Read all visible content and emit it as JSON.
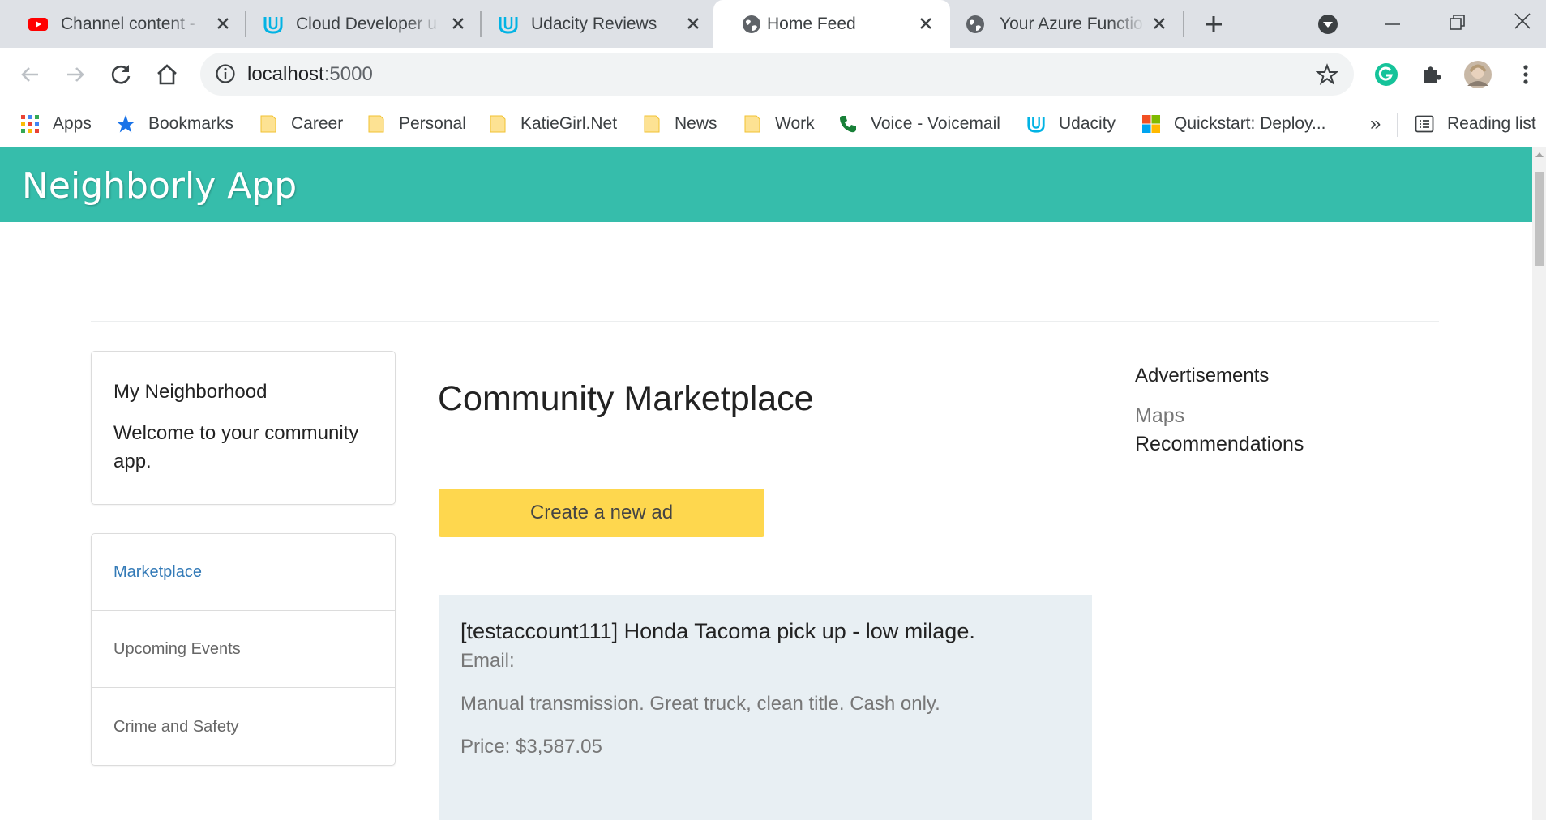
{
  "browser": {
    "tabs": [
      {
        "title": "Channel content -",
        "icon": "youtube-icon"
      },
      {
        "title": "Cloud Developer u",
        "icon": "udacity-icon"
      },
      {
        "title": "Udacity Reviews",
        "icon": "udacity-icon"
      },
      {
        "title": "Home Feed",
        "icon": "globe-icon",
        "active": true
      },
      {
        "title": "Your Azure Functio",
        "icon": "globe-icon"
      }
    ],
    "address": {
      "host": "localhost",
      "port": ":5000"
    },
    "bookmarks": [
      {
        "label": "Apps",
        "icon": "apps-grid-icon"
      },
      {
        "label": "Bookmarks",
        "icon": "star-icon"
      },
      {
        "label": "Career",
        "icon": "folder-icon"
      },
      {
        "label": "Personal",
        "icon": "folder-icon"
      },
      {
        "label": "KatieGirl.Net",
        "icon": "folder-icon"
      },
      {
        "label": "News",
        "icon": "folder-icon"
      },
      {
        "label": "Work",
        "icon": "folder-icon"
      },
      {
        "label": "Voice - Voicemail",
        "icon": "phone-icon"
      },
      {
        "label": "Udacity",
        "icon": "udacity-icon"
      },
      {
        "label": "Quickstart: Deploy...",
        "icon": "microsoft-icon"
      }
    ],
    "overflow_label": "»",
    "reading_list": "Reading list"
  },
  "app": {
    "title": "Neighborly App",
    "welcome": {
      "title": "My Neighborhood",
      "text": "Welcome to your community app."
    },
    "nav": [
      "Marketplace",
      "Upcoming Events",
      "Crime and Safety"
    ],
    "marketplace_title": "Community Marketplace",
    "create_button": "Create a new ad",
    "ad": {
      "title": "[testaccount111] Honda Tacoma pick up - low milage.",
      "email": "Email:",
      "description": "Manual transmission. Great truck, clean title. Cash only.",
      "price": "Price: $3,587.05"
    },
    "sidebar": {
      "heading": "Advertisements",
      "links": [
        "Maps",
        "Recommendations"
      ]
    }
  },
  "colors": {
    "header": "#36bdab",
    "button": "#fed74e",
    "ad_card": "#e8eff3",
    "link": "#337ab7"
  }
}
